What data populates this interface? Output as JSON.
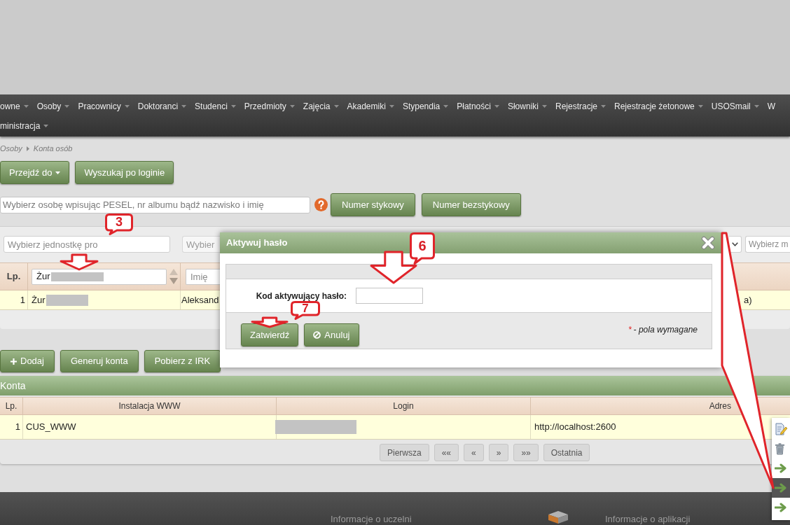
{
  "nav": {
    "rows": [
      [
        {
          "label": "owne",
          "dropdown": true
        },
        {
          "label": "Osoby",
          "dropdown": true
        },
        {
          "label": "Pracownicy",
          "dropdown": true
        },
        {
          "label": "Doktoranci",
          "dropdown": true
        },
        {
          "label": "Studenci",
          "dropdown": true
        },
        {
          "label": "Przedmioty",
          "dropdown": true
        },
        {
          "label": "Zajęcia",
          "dropdown": true
        },
        {
          "label": "Akademiki",
          "dropdown": true
        },
        {
          "label": "Stypendia",
          "dropdown": true
        },
        {
          "label": "Płatności",
          "dropdown": true
        },
        {
          "label": "Słowniki",
          "dropdown": true
        },
        {
          "label": "Rejestracje",
          "dropdown": true
        },
        {
          "label": "Rejestracje żetonowe",
          "dropdown": true
        },
        {
          "label": "USOSmail",
          "dropdown": true
        },
        {
          "label": "W",
          "dropdown": false
        }
      ],
      [
        {
          "label": "ministracja",
          "dropdown": true
        }
      ]
    ]
  },
  "breadcrumb": [
    {
      "label": "Osoby"
    },
    {
      "label": "Konta osób"
    }
  ],
  "actions": [
    {
      "label": "Przejdź do",
      "dropdown": true
    },
    {
      "label": "Wyszukaj po loginie",
      "dropdown": false
    }
  ],
  "person_search": {
    "placeholder": "Wybierz osobę wpisując PESEL, nr albumu bądź nazwisko i imię",
    "buttons": [
      {
        "label": "Numer stykowy"
      },
      {
        "label": "Numer bezstykowy"
      }
    ]
  },
  "filters": {
    "left": [
      {
        "placeholder": "Wybierz jednostkę pro"
      },
      {
        "placeholder": "Wybier"
      }
    ],
    "right": [
      {
        "kind": "select"
      },
      {
        "kind": "input",
        "placeholder": "Wybierz m"
      }
    ]
  },
  "people_table": {
    "header": [
      {
        "kind": "label",
        "label": "Lp."
      },
      {
        "kind": "filter",
        "value": "Żur",
        "redacted": true,
        "sortable": true
      },
      {
        "kind": "filter",
        "placeholder": "Imię",
        "sortable": false
      }
    ],
    "rows": [
      {
        "lp": "1",
        "surname": "Żur",
        "redacted": true,
        "first_name": "Aleksand",
        "last_column": "a)"
      }
    ]
  },
  "dialog": {
    "title": "Aktywuj hasło",
    "field_label": "Kod aktywujący hasło:",
    "buttons": [
      {
        "label": "Zatwierdź",
        "kind": "submit"
      },
      {
        "label": "Anuluj",
        "kind": "cancel"
      }
    ],
    "required_mark": "*",
    "required_note": "- pola wymagane"
  },
  "list_actions": [
    {
      "label": "Dodaj",
      "kind": "add"
    },
    {
      "label": "Generuj konta",
      "kind": "plain"
    },
    {
      "label": "Pobierz z IRK",
      "kind": "plain"
    }
  ],
  "accounts": {
    "title": "Konta",
    "columns": [
      {
        "label": "Lp."
      },
      {
        "label": "Instalacja WWW"
      },
      {
        "label": "Login"
      },
      {
        "label": "Adres"
      }
    ],
    "rows": [
      {
        "lp": "1",
        "installation": "CUS_WWW",
        "login_redacted": true,
        "address": "http://localhost:2600"
      }
    ]
  },
  "pagination": [
    {
      "label": "Pierwsza"
    },
    {
      "label": "««"
    },
    {
      "label": "«"
    },
    {
      "label": "»"
    },
    {
      "label": "»»"
    },
    {
      "label": "Ostatnia"
    }
  ],
  "context_menu": [
    {
      "kind": "edit",
      "selected": false
    },
    {
      "kind": "delete",
      "selected": false
    },
    {
      "kind": "go",
      "selected": false
    },
    {
      "kind": "go",
      "selected": true
    },
    {
      "kind": "go",
      "selected": false
    }
  ],
  "callouts": [
    {
      "number": "3"
    },
    {
      "number": "6"
    },
    {
      "number": "7"
    }
  ],
  "footer": [
    {
      "label": "Informacje o uczelni"
    },
    {
      "label": "Informacje o aplikacji"
    }
  ]
}
